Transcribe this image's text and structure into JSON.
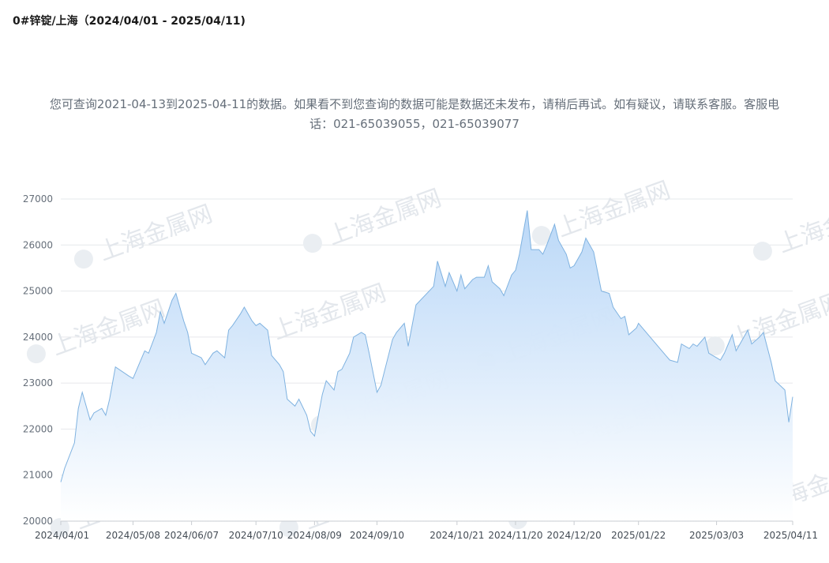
{
  "header": {
    "title": "0#锌锭/上海（2024/04/01 - 2025/04/11)"
  },
  "notice": {
    "line1": "您可查询2021-04-13到2025-04-11的数据。如果看不到您查询的数据可能是数据还未发布，请稍后再试。如有疑议，请联系客服。客服电",
    "line2": "话：021-65039055，021-65039077"
  },
  "watermark": {
    "text": "上海金属网"
  },
  "colors": {
    "line": "#7fb2e0",
    "fill_top": "#b7d6f7",
    "fill_bottom": "#ffffff",
    "grid": "#e6e8eb"
  },
  "chart_data": {
    "type": "area",
    "title": "0#锌锭/上海（2024/04/01 - 2025/04/11)",
    "xlabel": "",
    "ylabel": "",
    "ylim": [
      20000,
      27000
    ],
    "y_ticks": [
      20000,
      21000,
      22000,
      23000,
      24000,
      25000,
      26000,
      27000
    ],
    "x_tick_labels": [
      "2024/04/01",
      "2024/05/08",
      "2024/06/07",
      "2024/07/10",
      "2024/08/09",
      "2024/09/10",
      "2024/10/21",
      "2024/11/20",
      "2024/12/20",
      "2025/01/22",
      "2025/03/03",
      "2025/04/11"
    ],
    "grid": true,
    "legend": "none",
    "x": [
      "2024/04/01",
      "2024/04/03",
      "2024/04/08",
      "2024/04/10",
      "2024/04/12",
      "2024/04/16",
      "2024/04/18",
      "2024/04/22",
      "2024/04/24",
      "2024/04/26",
      "2024/04/29",
      "2024/05/06",
      "2024/05/08",
      "2024/05/10",
      "2024/05/14",
      "2024/05/16",
      "2024/05/20",
      "2024/05/22",
      "2024/05/24",
      "2024/05/28",
      "2024/05/30",
      "2024/06/03",
      "2024/06/05",
      "2024/06/07",
      "2024/06/12",
      "2024/06/14",
      "2024/06/18",
      "2024/06/20",
      "2024/06/24",
      "2024/06/26",
      "2024/06/28",
      "2024/07/02",
      "2024/07/04",
      "2024/07/08",
      "2024/07/10",
      "2024/07/12",
      "2024/07/16",
      "2024/07/18",
      "2024/07/22",
      "2024/07/24",
      "2024/07/26",
      "2024/07/30",
      "2024/08/01",
      "2024/08/05",
      "2024/08/07",
      "2024/08/09",
      "2024/08/13",
      "2024/08/15",
      "2024/08/19",
      "2024/08/21",
      "2024/08/23",
      "2024/08/27",
      "2024/08/29",
      "2024/09/02",
      "2024/09/04",
      "2024/09/06",
      "2024/09/10",
      "2024/09/12",
      "2024/09/18",
      "2024/09/20",
      "2024/09/24",
      "2024/09/26",
      "2024/09/30",
      "2024/10/09",
      "2024/10/11",
      "2024/10/15",
      "2024/10/17",
      "2024/10/21",
      "2024/10/23",
      "2024/10/25",
      "2024/10/29",
      "2024/10/31",
      "2024/11/04",
      "2024/11/06",
      "2024/11/08",
      "2024/11/12",
      "2024/11/14",
      "2024/11/18",
      "2024/11/20",
      "2024/11/22",
      "2024/11/26",
      "2024/11/28",
      "2024/12/02",
      "2024/12/04",
      "2024/12/06",
      "2024/12/10",
      "2024/12/12",
      "2024/12/16",
      "2024/12/18",
      "2024/12/20",
      "2024/12/24",
      "2024/12/26",
      "2024/12/30",
      "2025/01/03",
      "2025/01/07",
      "2025/01/09",
      "2025/01/13",
      "2025/01/15",
      "2025/01/17",
      "2025/01/21",
      "2025/01/22",
      "2025/02/05",
      "2025/02/07",
      "2025/02/11",
      "2025/02/13",
      "2025/02/17",
      "2025/02/19",
      "2025/02/21",
      "2025/02/25",
      "2025/02/27",
      "2025/03/03",
      "2025/03/05",
      "2025/03/07",
      "2025/03/11",
      "2025/03/13",
      "2025/03/17",
      "2025/03/19",
      "2025/03/21",
      "2025/03/25",
      "2025/03/27",
      "2025/03/31",
      "2025/04/02",
      "2025/04/07",
      "2025/04/09",
      "2025/04/11"
    ],
    "y": [
      20850,
      21150,
      21700,
      22450,
      22800,
      22200,
      22350,
      22450,
      22300,
      22650,
      23350,
      23150,
      23100,
      23300,
      23700,
      23650,
      24100,
      24550,
      24300,
      24800,
      24950,
      24350,
      24100,
      23650,
      23550,
      23400,
      23650,
      23700,
      23550,
      24150,
      24250,
      24500,
      24650,
      24350,
      24250,
      24300,
      24150,
      23600,
      23400,
      23250,
      22650,
      22500,
      22650,
      22300,
      21950,
      21850,
      22750,
      23050,
      22850,
      23250,
      23300,
      23650,
      24000,
      24100,
      24050,
      23650,
      22800,
      22950,
      23950,
      24100,
      24300,
      23800,
      24700,
      25100,
      25650,
      25100,
      25400,
      25000,
      25350,
      25050,
      25250,
      25300,
      25300,
      25550,
      25200,
      25050,
      24900,
      25350,
      25450,
      25800,
      26750,
      25900,
      25900,
      25800,
      26000,
      26450,
      26100,
      25800,
      25500,
      25550,
      25850,
      26150,
      25850,
      25000,
      24950,
      24650,
      24400,
      24450,
      24050,
      24200,
      24300,
      23600,
      23500,
      23450,
      23850,
      23750,
      23850,
      23800,
      24000,
      23650,
      23550,
      23500,
      23650,
      24050,
      23700,
      24000,
      24150,
      23850,
      24000,
      24100,
      23450,
      23050,
      22850,
      22150,
      22700
    ]
  }
}
